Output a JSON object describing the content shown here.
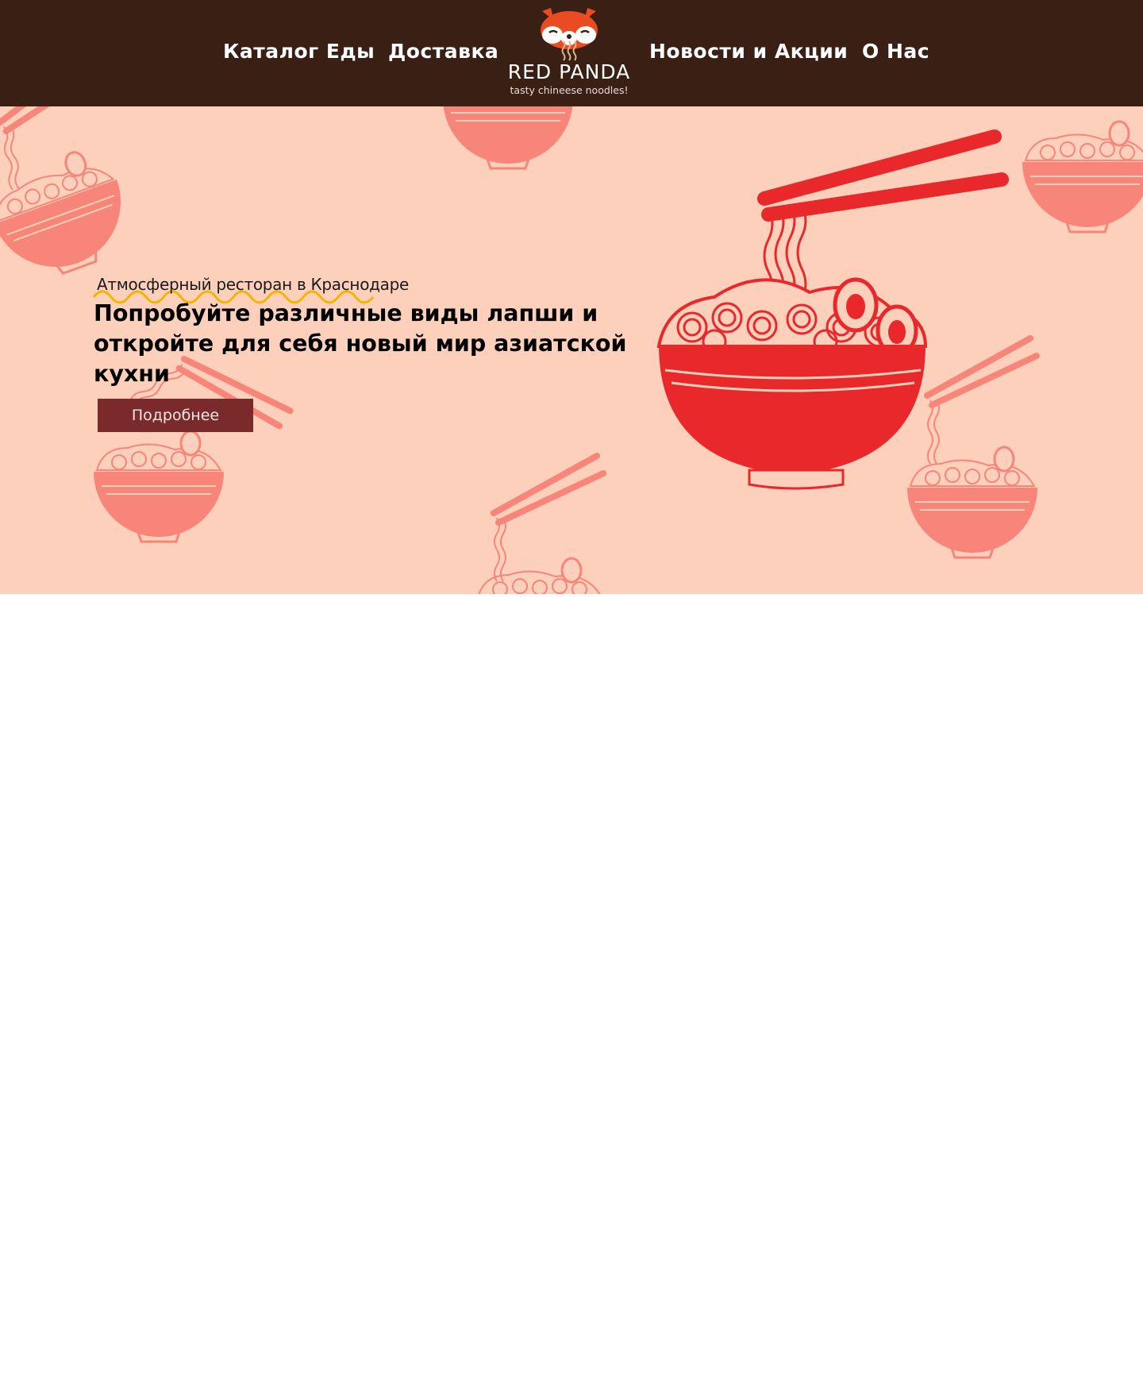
{
  "nav": {
    "left": [
      "Каталог Еды",
      "Доставка"
    ],
    "right": [
      "Новости и Акции",
      "О Нас"
    ]
  },
  "logo": {
    "title": "RED PANDA",
    "subtitle": "tasty chineese noodles!",
    "icon": "red-panda-icon"
  },
  "hero": {
    "tagline": "Атмосферный ресторан в Краснодаре",
    "headline": "Попробуйте различные виды лапши и откройте для себя новый мир азиатской кухни",
    "button_label": "Подробнее",
    "illustration": "noodle-bowl-chopsticks"
  },
  "colors": {
    "header_bg": "#3a1f14",
    "hero_bg": "#fdd0bb",
    "accent_red": "#e8282b",
    "pattern_pink": "#f7857a",
    "button_bg": "#7a2a2b",
    "tagline_wave": "#f4b400"
  }
}
